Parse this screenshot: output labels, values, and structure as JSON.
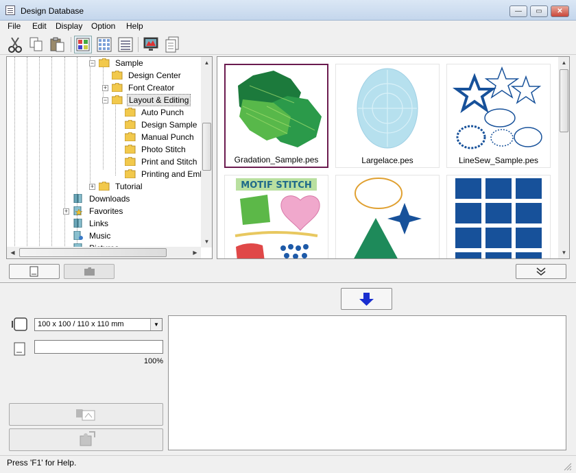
{
  "window": {
    "title": "Design Database",
    "buttons": {
      "minimize": "—",
      "maximize": "▭",
      "close": "✕"
    }
  },
  "menu": [
    "File",
    "Edit",
    "Display",
    "Option",
    "Help"
  ],
  "toolbar": {
    "icons": [
      "cut-icon",
      "copy-icon",
      "paste-icon",
      "large-thumbnails-icon",
      "small-thumbnails-icon",
      "details-view-icon",
      "monitor-icon",
      "properties-icon"
    ]
  },
  "tree": {
    "items": [
      {
        "label": "Sample"
      },
      {
        "label": "Design Center"
      },
      {
        "label": "Font Creator"
      },
      {
        "label": "Layout & Editing"
      },
      {
        "label": "Auto Punch"
      },
      {
        "label": "Design Sample"
      },
      {
        "label": "Manual Punch"
      },
      {
        "label": "Photo Stitch"
      },
      {
        "label": "Print and Stitch"
      },
      {
        "label": "Printing and Emb"
      },
      {
        "label": "Tutorial"
      },
      {
        "label": "Downloads"
      },
      {
        "label": "Favorites"
      },
      {
        "label": "Links"
      },
      {
        "label": "Music"
      },
      {
        "label": "Pictures"
      }
    ],
    "selected": "Layout & Editing"
  },
  "thumbnails": [
    {
      "name": "Gradation_Sample.pes"
    },
    {
      "name": "Largelace.pes"
    },
    {
      "name": "LineSew_Sample.pes"
    },
    {
      "name": ""
    },
    {
      "name": ""
    },
    {
      "name": ""
    }
  ],
  "motif_text": "MOTIF STITCH",
  "hoop": {
    "selected": "100 x 100 / 110 x 110 mm"
  },
  "name_field": {
    "value": ""
  },
  "zoom": "100%",
  "status": "Press 'F1' for Help.",
  "colors": {
    "accent_border": "#6a1a4e",
    "down_arrow": "#1a2fd0"
  }
}
